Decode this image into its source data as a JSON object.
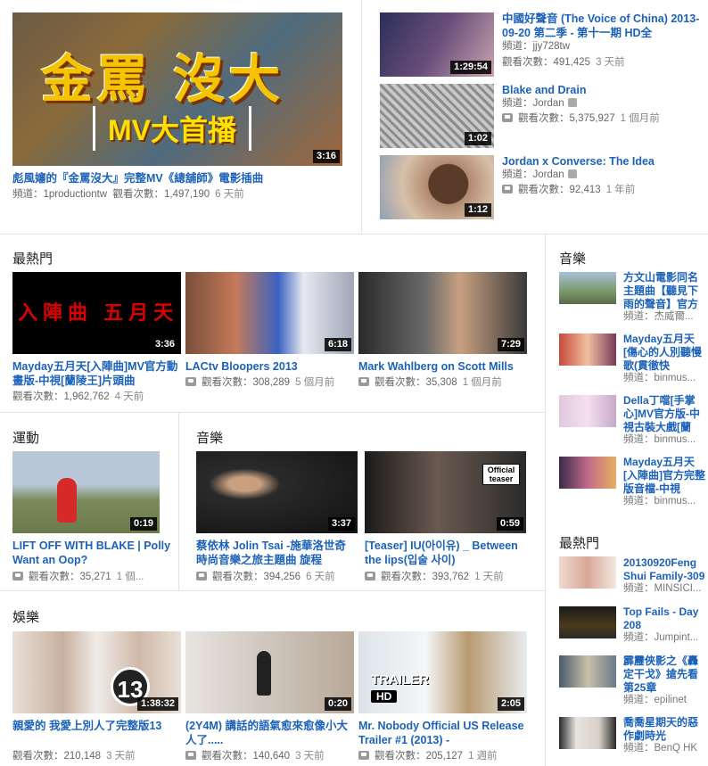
{
  "feature": {
    "main": {
      "thumb_text": "金罵 沒大",
      "thumb_sub": "MV大首播",
      "duration": "3:16",
      "title": "彪風嬸的『金罵沒大』完整MV《總舖師》電影插曲",
      "channel_label": "頻道：",
      "channel": "1productiontw",
      "views_label": "觀看次數：",
      "views": "1,497,190",
      "ago": "6 天前"
    },
    "side": [
      {
        "duration": "1:29:54",
        "title": "中國好聲音 (The Voice of China) 2013-09-20 第二季 - 第十一期 HD全",
        "channel_label": "頻道：",
        "channel": "jjy728tw",
        "views_label": "觀看次數：",
        "views": "491,425",
        "ago": "3 天前"
      },
      {
        "duration": "1:02",
        "title": "Blake and Drain",
        "channel_label": "頻道：",
        "channel": "Jordan",
        "views_label": "觀看次數：",
        "views": "5,375,927",
        "ago": "1 個月前"
      },
      {
        "duration": "1:12",
        "title": "Jordan x Converse: The Idea",
        "channel_label": "頻道：",
        "channel": "Jordan",
        "views_label": "觀看次數：",
        "views": "92,413",
        "ago": "1 年前"
      }
    ]
  },
  "popular": {
    "heading": "最熱門",
    "items": [
      {
        "thumb_text": "入陣曲  五月天",
        "duration": "3:36",
        "title": "Mayday五月天[入陣曲]MV官方動畫版-中視[蘭陵王]片頭曲",
        "views_label": "觀看次數：",
        "views": "1,962,762",
        "ago": "4 天前"
      },
      {
        "duration": "6:18",
        "title": "LACtv Bloopers 2013",
        "views_label": "觀看次數：",
        "views": "308,289",
        "ago": "5 個月前"
      },
      {
        "duration": "7:29",
        "title": "Mark Wahlberg on Scott Mills",
        "views_label": "觀看次數：",
        "views": "35,308",
        "ago": "1 個月前"
      }
    ]
  },
  "sports": {
    "heading": "運動",
    "items": [
      {
        "duration": "0:19",
        "title": "LIFT OFF WITH BLAKE | Polly Want an Oop?",
        "views_label": "觀看次數：",
        "views": "35,271",
        "ago": "1 個..."
      }
    ]
  },
  "music": {
    "heading": "音樂",
    "items": [
      {
        "duration": "3:37",
        "title": "蔡依林 Jolin Tsai -施華洛世奇時尚音樂之旅主題曲 旋程",
        "views_label": "觀看次數：",
        "views": "394,256",
        "ago": "6 天前"
      },
      {
        "duration": "0:59",
        "badge": "Official teaser",
        "title": "[Teaser] IU(아이유) _ Between the lips(입술 사이)",
        "views_label": "觀看次數：",
        "views": "393,762",
        "ago": "1 天前"
      }
    ]
  },
  "entertainment": {
    "heading": "娛樂",
    "items": [
      {
        "duration": "1:38:32",
        "badge": "13",
        "title": "親愛的 我愛上別人了完整版13",
        "views_label": "觀看次數：",
        "views": "210,148",
        "ago": "3 天前"
      },
      {
        "duration": "0:20",
        "title": "(2Y4M) 講話的語氣愈來愈像小大人了.....",
        "views_label": "觀看次數：",
        "views": "140,640",
        "ago": "3 天前"
      },
      {
        "duration": "2:05",
        "badge": "TRAILER",
        "badge2": "HD",
        "title": "Mr. Nobody Official US Release Trailer #1 (2013) -",
        "views_label": "觀看次數：",
        "views": "205,127",
        "ago": "1 週前"
      }
    ]
  },
  "right_music": {
    "heading": "音樂",
    "items": [
      {
        "title": "方文山電影同名主題曲【聽見下雨的聲音】官方完",
        "channel_label": "頻道：",
        "channel": "杰威爾..."
      },
      {
        "title": "Mayday五月天[傷心的人別聽慢歌(貫徹快",
        "channel_label": "頻道：",
        "channel": "binmus..."
      },
      {
        "title": "Della丁噹[手掌心]MV官方版-中視古裝大戲[蘭",
        "channel_label": "頻道：",
        "channel": "binmus..."
      },
      {
        "title": "Mayday五月天[入陣曲]官方完整版音檔-中視",
        "channel_label": "頻道：",
        "channel": "binmus..."
      }
    ]
  },
  "right_popular": {
    "heading": "最熱門",
    "items": [
      {
        "title": "20130920Feng Shui Family-309",
        "channel_label": "頻道：",
        "channel": "MINSICI..."
      },
      {
        "title": "Top Fails - Day 208",
        "channel_label": "頻道：",
        "channel": "Jumpint..."
      },
      {
        "title": "霹靂俠影之《轟定干戈》搶先看第25章",
        "channel_label": "頻道：",
        "channel": "epilinet"
      },
      {
        "title": "喬喬星期天的惡作劇時光",
        "channel_label": "頻道：",
        "channel": "BenQ HK"
      }
    ]
  },
  "colors": {
    "link": "#1c62b9",
    "meta": "#666666",
    "divider": "#e2e2e2"
  }
}
